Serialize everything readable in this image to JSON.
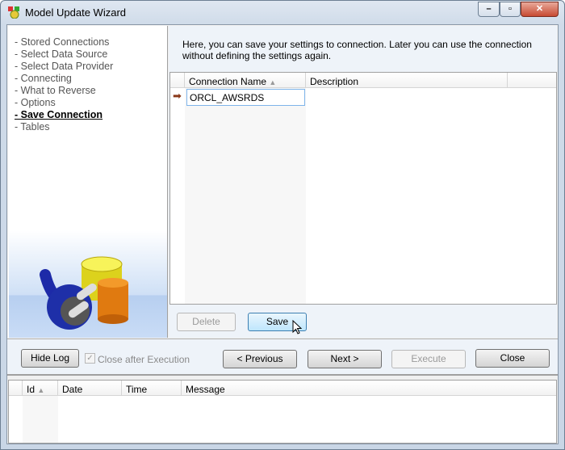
{
  "window": {
    "title": "Model Update Wizard",
    "icon": "app-icon",
    "controls": [
      "minimize",
      "maximize",
      "close"
    ]
  },
  "steps": [
    {
      "label": "- Stored Connections",
      "current": false
    },
    {
      "label": "- Select Data Source",
      "current": false
    },
    {
      "label": "- Select Data Provider",
      "current": false
    },
    {
      "label": "- Connecting",
      "current": false
    },
    {
      "label": "- What to Reverse",
      "current": false
    },
    {
      "label": "- Options",
      "current": false
    },
    {
      "label": "- Save Connection",
      "current": true
    },
    {
      "label": "- Tables",
      "current": false
    }
  ],
  "main": {
    "description": "Here, you can save your settings to connection. Later you can use the connection without defining the settings again.",
    "grid": {
      "columns": [
        "Connection Name",
        "Description"
      ],
      "sort": "Connection Name ascending",
      "rows": [
        {
          "name": "ORCL_AWSRDS",
          "description": ""
        }
      ]
    },
    "delete_label": "Delete",
    "save_label": "Save"
  },
  "footer": {
    "hide_log": "Hide Log",
    "close_after_execution": "Close after Execution",
    "close_after_checked": true,
    "previous": "< Previous",
    "next": "Next >",
    "execute": "Execute",
    "close": "Close"
  },
  "log": {
    "columns": [
      "Id",
      "Date",
      "Time",
      "Message"
    ],
    "rows": []
  }
}
